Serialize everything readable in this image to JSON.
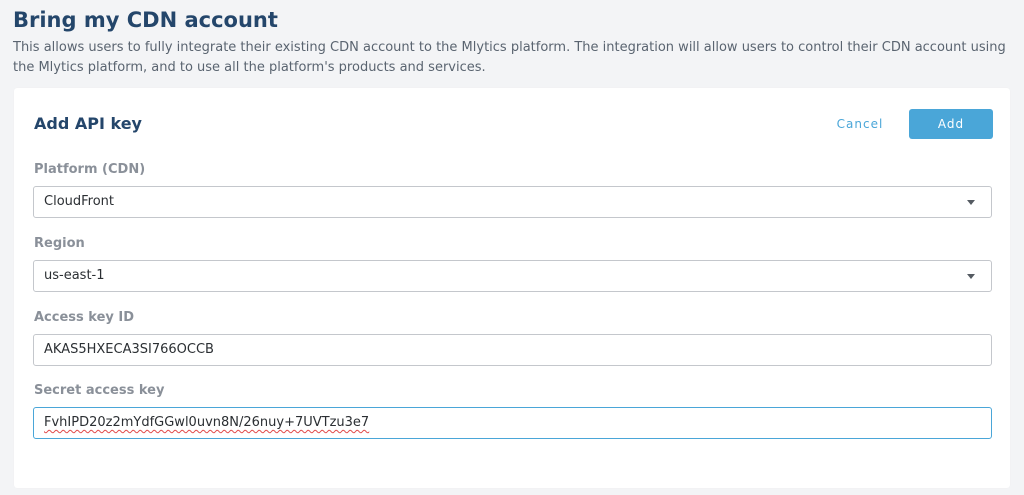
{
  "page": {
    "title": "Bring my CDN account",
    "description": "This allows users to fully integrate their existing CDN account to the Mlytics platform. The integration will allow users to control their CDN account using the Mlytics platform, and to use all the platform's products and services."
  },
  "card": {
    "title": "Add API key",
    "cancel_label": "Cancel",
    "add_label": "Add"
  },
  "form": {
    "platform": {
      "label": "Platform (CDN)",
      "value": "CloudFront"
    },
    "region": {
      "label": "Region",
      "value": "us-east-1"
    },
    "access_key_id": {
      "label": "Access key ID",
      "value": "AKAS5HXECA3SI766OCCB"
    },
    "secret_access_key": {
      "label": "Secret access key",
      "value": "FvhIPD20z2mYdfGGwl0uvn8N/26nuy+7UVTzu3e7"
    }
  },
  "colors": {
    "accent": "#4aa6d8",
    "title": "#24466b",
    "background": "#f3f4f6"
  },
  "icons": {
    "dropdown": "chevron-down-icon"
  }
}
